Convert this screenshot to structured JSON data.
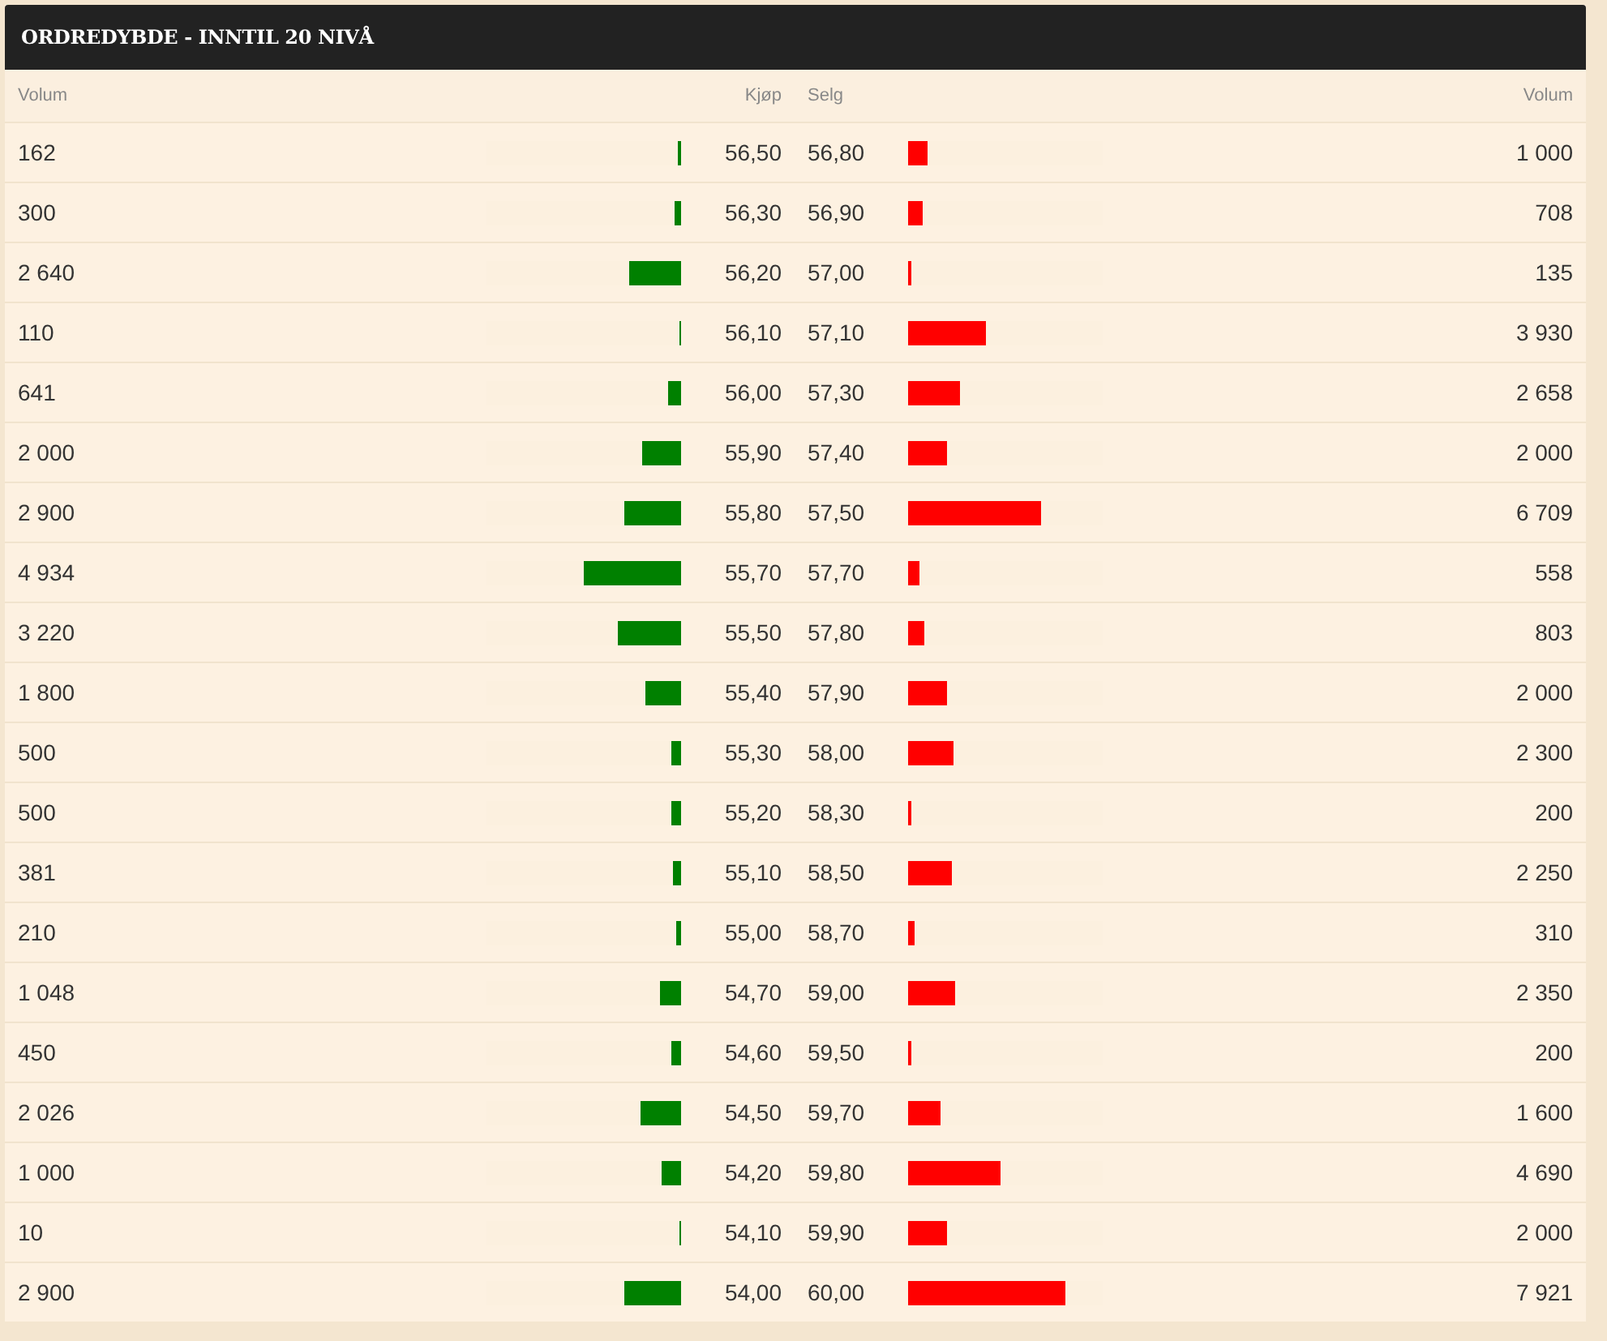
{
  "panel": {
    "title": "ORDREDYBDE - INNTIL 20 NIVÅ"
  },
  "table": {
    "columns": [
      "Volum",
      "Kjøp",
      "Selg",
      "Volum"
    ],
    "rows": [
      {
        "bid": {
          "volume": "162",
          "level": 0.016,
          "price": "56,50"
        },
        "ask": {
          "price": "56,80",
          "level": 0.102,
          "volume": "1 000"
        }
      },
      {
        "bid": {
          "volume": "300",
          "level": 0.03,
          "price": "56,30"
        },
        "ask": {
          "price": "56,90",
          "level": 0.072,
          "volume": "708"
        }
      },
      {
        "bid": {
          "volume": "2 640",
          "level": 0.268,
          "price": "56,20"
        },
        "ask": {
          "price": "57,00",
          "level": 0.014,
          "volume": "135"
        }
      },
      {
        "bid": {
          "volume": "110",
          "level": 0.011,
          "price": "56,10"
        },
        "ask": {
          "price": "57,10",
          "level": 0.4,
          "volume": "3 930"
        }
      },
      {
        "bid": {
          "volume": "641",
          "level": 0.065,
          "price": "56,00"
        },
        "ask": {
          "price": "57,30",
          "level": 0.27,
          "volume": "2 658"
        }
      },
      {
        "bid": {
          "volume": "2 000",
          "level": 0.203,
          "price": "55,90"
        },
        "ask": {
          "price": "57,40",
          "level": 0.203,
          "volume": "2 000"
        }
      },
      {
        "bid": {
          "volume": "2 900",
          "level": 0.295,
          "price": "55,80"
        },
        "ask": {
          "price": "57,50",
          "level": 0.682,
          "volume": "6 709"
        }
      },
      {
        "bid": {
          "volume": "4 934",
          "level": 0.502,
          "price": "55,70"
        },
        "ask": {
          "price": "57,70",
          "level": 0.057,
          "volume": "558"
        }
      },
      {
        "bid": {
          "volume": "3 220",
          "level": 0.327,
          "price": "55,50"
        },
        "ask": {
          "price": "57,80",
          "level": 0.082,
          "volume": "803"
        }
      },
      {
        "bid": {
          "volume": "1 800",
          "level": 0.183,
          "price": "55,40"
        },
        "ask": {
          "price": "57,90",
          "level": 0.203,
          "volume": "2 000"
        }
      },
      {
        "bid": {
          "volume": "500",
          "level": 0.051,
          "price": "55,30"
        },
        "ask": {
          "price": "58,00",
          "level": 0.234,
          "volume": "2 300"
        }
      },
      {
        "bid": {
          "volume": "500",
          "level": 0.051,
          "price": "55,20"
        },
        "ask": {
          "price": "58,30",
          "level": 0.02,
          "volume": "200"
        }
      },
      {
        "bid": {
          "volume": "381",
          "level": 0.039,
          "price": "55,10"
        },
        "ask": {
          "price": "58,50",
          "level": 0.229,
          "volume": "2 250"
        }
      },
      {
        "bid": {
          "volume": "210",
          "level": 0.021,
          "price": "55,00"
        },
        "ask": {
          "price": "58,70",
          "level": 0.032,
          "volume": "310"
        }
      },
      {
        "bid": {
          "volume": "1 048",
          "level": 0.107,
          "price": "54,70"
        },
        "ask": {
          "price": "59,00",
          "level": 0.239,
          "volume": "2 350"
        }
      },
      {
        "bid": {
          "volume": "450",
          "level": 0.046,
          "price": "54,60"
        },
        "ask": {
          "price": "59,50",
          "level": 0.02,
          "volume": "200"
        }
      },
      {
        "bid": {
          "volume": "2 026",
          "level": 0.206,
          "price": "54,50"
        },
        "ask": {
          "price": "59,70",
          "level": 0.163,
          "volume": "1 600"
        }
      },
      {
        "bid": {
          "volume": "1 000",
          "level": 0.102,
          "price": "54,20"
        },
        "ask": {
          "price": "59,80",
          "level": 0.477,
          "volume": "4 690"
        }
      },
      {
        "bid": {
          "volume": "10",
          "level": 0.001,
          "price": "54,10"
        },
        "ask": {
          "price": "59,90",
          "level": 0.203,
          "volume": "2 000"
        }
      },
      {
        "bid": {
          "volume": "2 900",
          "level": 0.295,
          "price": "54,00"
        },
        "ask": {
          "price": "60,00",
          "level": 0.805,
          "volume": "7 921"
        }
      }
    ]
  }
}
